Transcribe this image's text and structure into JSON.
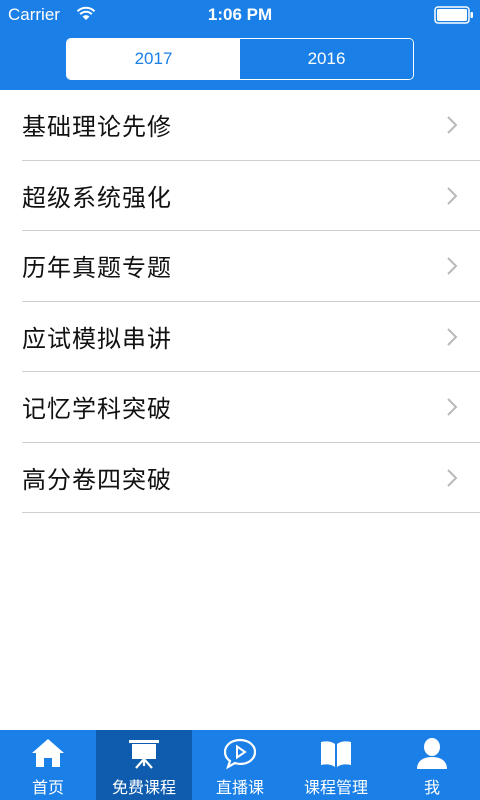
{
  "status_bar": {
    "carrier": "Carrier",
    "time": "1:06 PM"
  },
  "year_tabs": [
    {
      "label": "2017",
      "active": true
    },
    {
      "label": "2016",
      "active": false
    }
  ],
  "course_list": [
    {
      "label": "基础理论先修"
    },
    {
      "label": "超级系统强化"
    },
    {
      "label": "历年真题专题"
    },
    {
      "label": "应试模拟串讲"
    },
    {
      "label": "记忆学科突破"
    },
    {
      "label": "高分卷四突破"
    }
  ],
  "tab_bar": [
    {
      "label": "首页",
      "icon": "home-icon",
      "selected": false
    },
    {
      "label": "免费课程",
      "icon": "presentation-board-icon",
      "selected": true
    },
    {
      "label": "直播课",
      "icon": "play-chat-icon",
      "selected": false
    },
    {
      "label": "课程管理",
      "icon": "book-icon",
      "selected": false
    },
    {
      "label": "我",
      "icon": "person-icon",
      "selected": false
    }
  ],
  "colors": {
    "primary": "#1a7fe6",
    "tab_selected": "#0f5cae",
    "divider": "#cfcfcf"
  }
}
